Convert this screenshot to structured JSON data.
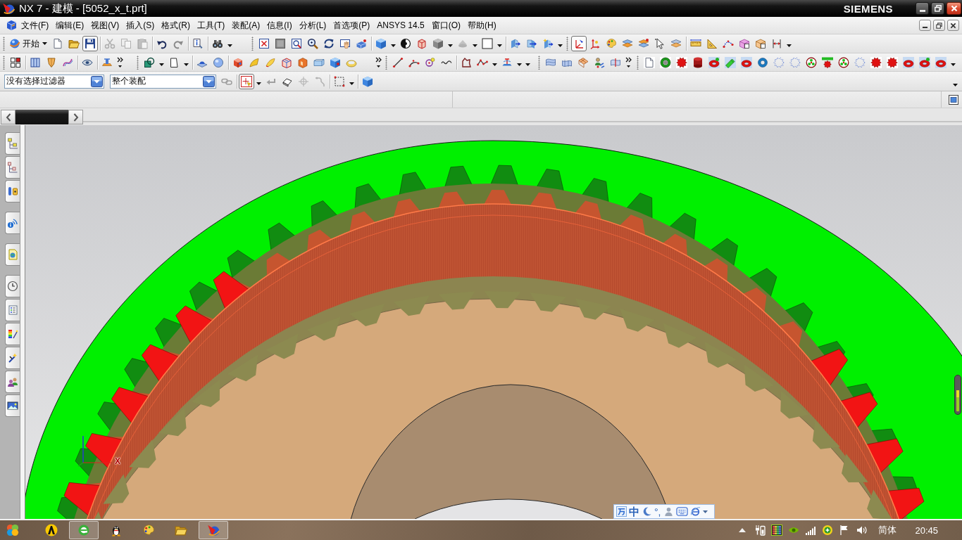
{
  "window": {
    "title": "NX 7 - 建模 - [5052_x_t.prt]",
    "brand": "SIEMENS"
  },
  "menu": [
    {
      "label": "文件(F)"
    },
    {
      "label": "编辑(E)"
    },
    {
      "label": "视图(V)"
    },
    {
      "label": "插入(S)"
    },
    {
      "label": "格式(R)"
    },
    {
      "label": "工具(T)"
    },
    {
      "label": "装配(A)"
    },
    {
      "label": "信息(I)"
    },
    {
      "label": "分析(L)"
    },
    {
      "label": "首选项(P)"
    },
    {
      "label": "ANSYS 14.5"
    },
    {
      "label": "窗口(O)"
    },
    {
      "label": "帮助(H)"
    }
  ],
  "start_button": {
    "label": "开始"
  },
  "toolbars": [
    {
      "buttons": [
        {
          "pressed": false,
          "disabled": false
        },
        {
          "pressed": false,
          "disabled": false
        },
        {
          "pressed": true,
          "disabled": false
        },
        {
          "pressed": false,
          "disabled": true
        },
        {
          "pressed": false,
          "disabled": true
        },
        {
          "pressed": false,
          "disabled": true
        },
        {
          "pressed": false,
          "disabled": false
        },
        {
          "pressed": false,
          "disabled": true
        },
        {
          "pressed": false,
          "disabled": false
        },
        {
          "pressed": false,
          "disabled": false
        },
        {
          "pressed": false,
          "disabled": false
        },
        {
          "pressed": false,
          "disabled": false
        },
        {
          "pressed": false,
          "disabled": false
        },
        {
          "pressed": false,
          "disabled": false
        },
        {
          "pressed": false,
          "disabled": false
        },
        {
          "pressed": false,
          "disabled": false
        },
        {
          "pressed": false,
          "disabled": false
        },
        {
          "pressed": false,
          "disabled": false
        },
        {
          "pressed": false,
          "disabled": false
        },
        {
          "pressed": false,
          "disabled": false
        },
        {
          "pressed": false,
          "disabled": false
        },
        {
          "pressed": false,
          "disabled": true
        },
        {
          "pressed": false,
          "disabled": false
        },
        {
          "pressed": false,
          "disabled": false
        },
        {
          "pressed": false,
          "disabled": false
        },
        {
          "pressed": false,
          "disabled": false
        },
        {
          "pressed": true,
          "disabled": false
        },
        {
          "pressed": false,
          "disabled": false
        },
        {
          "pressed": false,
          "disabled": false
        },
        {
          "pressed": false,
          "disabled": false
        },
        {
          "pressed": false,
          "disabled": false
        },
        {
          "pressed": false,
          "disabled": false
        },
        {
          "pressed": false,
          "disabled": false
        },
        {
          "pressed": false,
          "disabled": false
        },
        {
          "pressed": false,
          "disabled": false
        },
        {
          "pressed": false,
          "disabled": false
        },
        {
          "pressed": false,
          "disabled": false
        },
        {
          "pressed": false,
          "disabled": false
        },
        {
          "pressed": false,
          "disabled": false
        }
      ]
    },
    {
      "buttons": [
        {
          "pressed": false,
          "disabled": false
        },
        {
          "pressed": false,
          "disabled": false
        },
        {
          "pressed": false,
          "disabled": false
        },
        {
          "pressed": false,
          "disabled": false
        },
        {
          "pressed": false,
          "disabled": false
        },
        {
          "pressed": false,
          "disabled": false
        },
        {
          "pressed": false,
          "disabled": false
        },
        {
          "pressed": false,
          "disabled": false
        },
        {
          "pressed": false,
          "disabled": false
        },
        {
          "pressed": false,
          "disabled": false
        },
        {
          "pressed": false,
          "disabled": false
        },
        {
          "pressed": false,
          "disabled": false
        },
        {
          "pressed": false,
          "disabled": false
        },
        {
          "pressed": false,
          "disabled": false
        },
        {
          "pressed": false,
          "disabled": false
        },
        {
          "pressed": false,
          "disabled": false
        },
        {
          "pressed": false,
          "disabled": false
        },
        {
          "pressed": false,
          "disabled": false
        },
        {
          "pressed": false,
          "disabled": false
        },
        {
          "pressed": false,
          "disabled": false
        },
        {
          "pressed": false,
          "disabled": false
        },
        {
          "pressed": false,
          "disabled": false
        },
        {
          "pressed": false,
          "disabled": false
        },
        {
          "pressed": false,
          "disabled": false
        },
        {
          "pressed": false,
          "disabled": false
        },
        {
          "pressed": false,
          "disabled": false
        },
        {
          "pressed": false,
          "disabled": false
        },
        {
          "pressed": false,
          "disabled": false
        },
        {
          "pressed": false,
          "disabled": false
        },
        {
          "pressed": false,
          "disabled": false
        },
        {
          "pressed": false,
          "disabled": false
        },
        {
          "pressed": false,
          "disabled": false
        },
        {
          "pressed": false,
          "disabled": false
        },
        {
          "pressed": false,
          "disabled": false
        },
        {
          "pressed": false,
          "disabled": false
        },
        {
          "pressed": false,
          "disabled": false
        },
        {
          "pressed": false,
          "disabled": false
        },
        {
          "pressed": false,
          "disabled": false
        },
        {
          "pressed": false,
          "disabled": false
        },
        {
          "pressed": false,
          "disabled": false
        },
        {
          "pressed": false,
          "disabled": false
        },
        {
          "pressed": false,
          "disabled": false
        },
        {
          "pressed": false,
          "disabled": false
        },
        {
          "pressed": false,
          "disabled": false
        },
        {
          "pressed": false,
          "disabled": false
        },
        {
          "pressed": false,
          "disabled": false
        },
        {
          "pressed": false,
          "disabled": false
        },
        {
          "pressed": false,
          "disabled": false
        },
        {
          "pressed": false,
          "disabled": false
        }
      ]
    },
    {
      "buttons": [
        {
          "pressed": false,
          "disabled": true
        },
        {
          "pressed": true,
          "disabled": false
        },
        {
          "pressed": false,
          "disabled": true
        },
        {
          "pressed": false,
          "disabled": false
        },
        {
          "pressed": false,
          "disabled": true
        },
        {
          "pressed": false,
          "disabled": true
        },
        {
          "pressed": false,
          "disabled": false
        },
        {
          "pressed": false,
          "disabled": false
        }
      ]
    }
  ],
  "filters": [
    {
      "value": "没有选择过滤器"
    },
    {
      "value": "整个装配"
    }
  ],
  "viewport": {
    "axis_label": "X"
  },
  "ime_bar": {
    "mode": "中",
    "punctuation": "°,"
  },
  "taskbar": {
    "items": [
      {
        "highlighted": false
      },
      {
        "highlighted": true
      },
      {
        "highlighted": false
      },
      {
        "highlighted": false
      },
      {
        "highlighted": false
      },
      {
        "highlighted": true
      }
    ],
    "language": "简体",
    "clock": "20:45"
  }
}
